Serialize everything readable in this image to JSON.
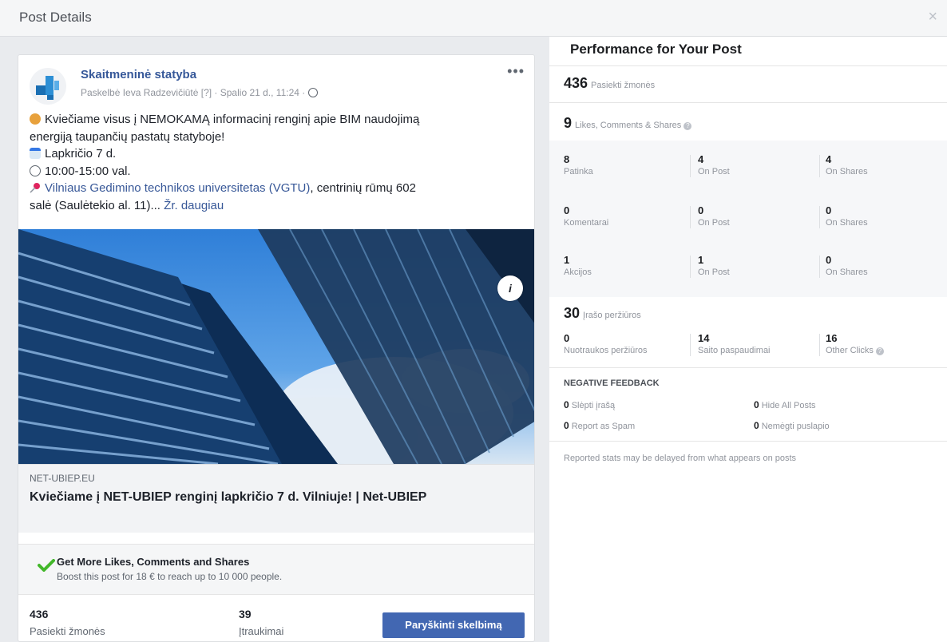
{
  "dialog": {
    "title": "Post Details",
    "close_icon": "×"
  },
  "post": {
    "page_name": "Skaitmeninė statyba",
    "meta": "Paskelbė Ieva Radzevičiūtė [?] · Spalio 21 d., 11:24 ·",
    "more_icon": "•••",
    "text_line1": "Kviečiame visus į NEMOKAMĄ informacinį renginį apie BIM naudojimą",
    "text_line2": "energiją taupančių pastatų statyboje!",
    "date": "Lapkričio 7 d.",
    "time": "10:00-15:00 val.",
    "location_link": "Vilniaus Gedimino technikos universitetas (VGTU)",
    "location_rest": ", centrinių rūmų 602",
    "location_line2": "salė (Saulėtekio al. 11)...",
    "see_more": "Žr. daugiau",
    "info_icon": "i"
  },
  "link_preview": {
    "domain": "NET-UBIEP.EU",
    "title": "Kviečiame į NET-UBIEP renginį lapkričio 7 d. Vilniuje! | Net-UBIEP"
  },
  "boost": {
    "title": "Get More Likes, Comments and Shares",
    "subtitle": "Boost this post for 18 € to reach up to 10 000 people.",
    "reached_value": "436",
    "reached_label": "Pasiekti žmonės",
    "engagements_value": "39",
    "engagements_label": "Įtraukimai",
    "button_label": "Paryškinti skelbimą"
  },
  "performance": {
    "title": "Performance for Your Post",
    "reached": {
      "value": "436",
      "label": "Pasiekti žmonės"
    },
    "interactions": {
      "value": "9",
      "label": "Likes, Comments & Shares"
    },
    "likes": [
      {
        "value": "8",
        "label": "Patinka"
      },
      {
        "value": "4",
        "label": "On Post"
      },
      {
        "value": "4",
        "label": "On Shares"
      }
    ],
    "comments": [
      {
        "value": "0",
        "label": "Komentarai"
      },
      {
        "value": "0",
        "label": "On Post"
      },
      {
        "value": "0",
        "label": "On Shares"
      }
    ],
    "shares": [
      {
        "value": "1",
        "label": "Akcijos"
      },
      {
        "value": "1",
        "label": "On Post"
      },
      {
        "value": "0",
        "label": "On Shares"
      }
    ],
    "post_views": {
      "value": "30",
      "label": "Įrašo peržiūros"
    },
    "clicks": [
      {
        "value": "0",
        "label": "Nuotraukos peržiūros"
      },
      {
        "value": "14",
        "label": "Saito paspaudimai"
      },
      {
        "value": "16",
        "label": "Other Clicks"
      }
    ],
    "negative_feedback": {
      "heading": "NEGATIVE FEEDBACK",
      "items": [
        {
          "value": "0",
          "label": "Slėpti įrašą"
        },
        {
          "value": "0",
          "label": "Hide All Posts"
        },
        {
          "value": "0",
          "label": "Report as Spam"
        },
        {
          "value": "0",
          "label": "Nemėgti puslapio"
        }
      ]
    },
    "note": "Reported stats may be delayed from what appears on posts"
  },
  "colors": {
    "link": "#365899",
    "boost_button": "#4267b2",
    "check": "#42b72a"
  }
}
